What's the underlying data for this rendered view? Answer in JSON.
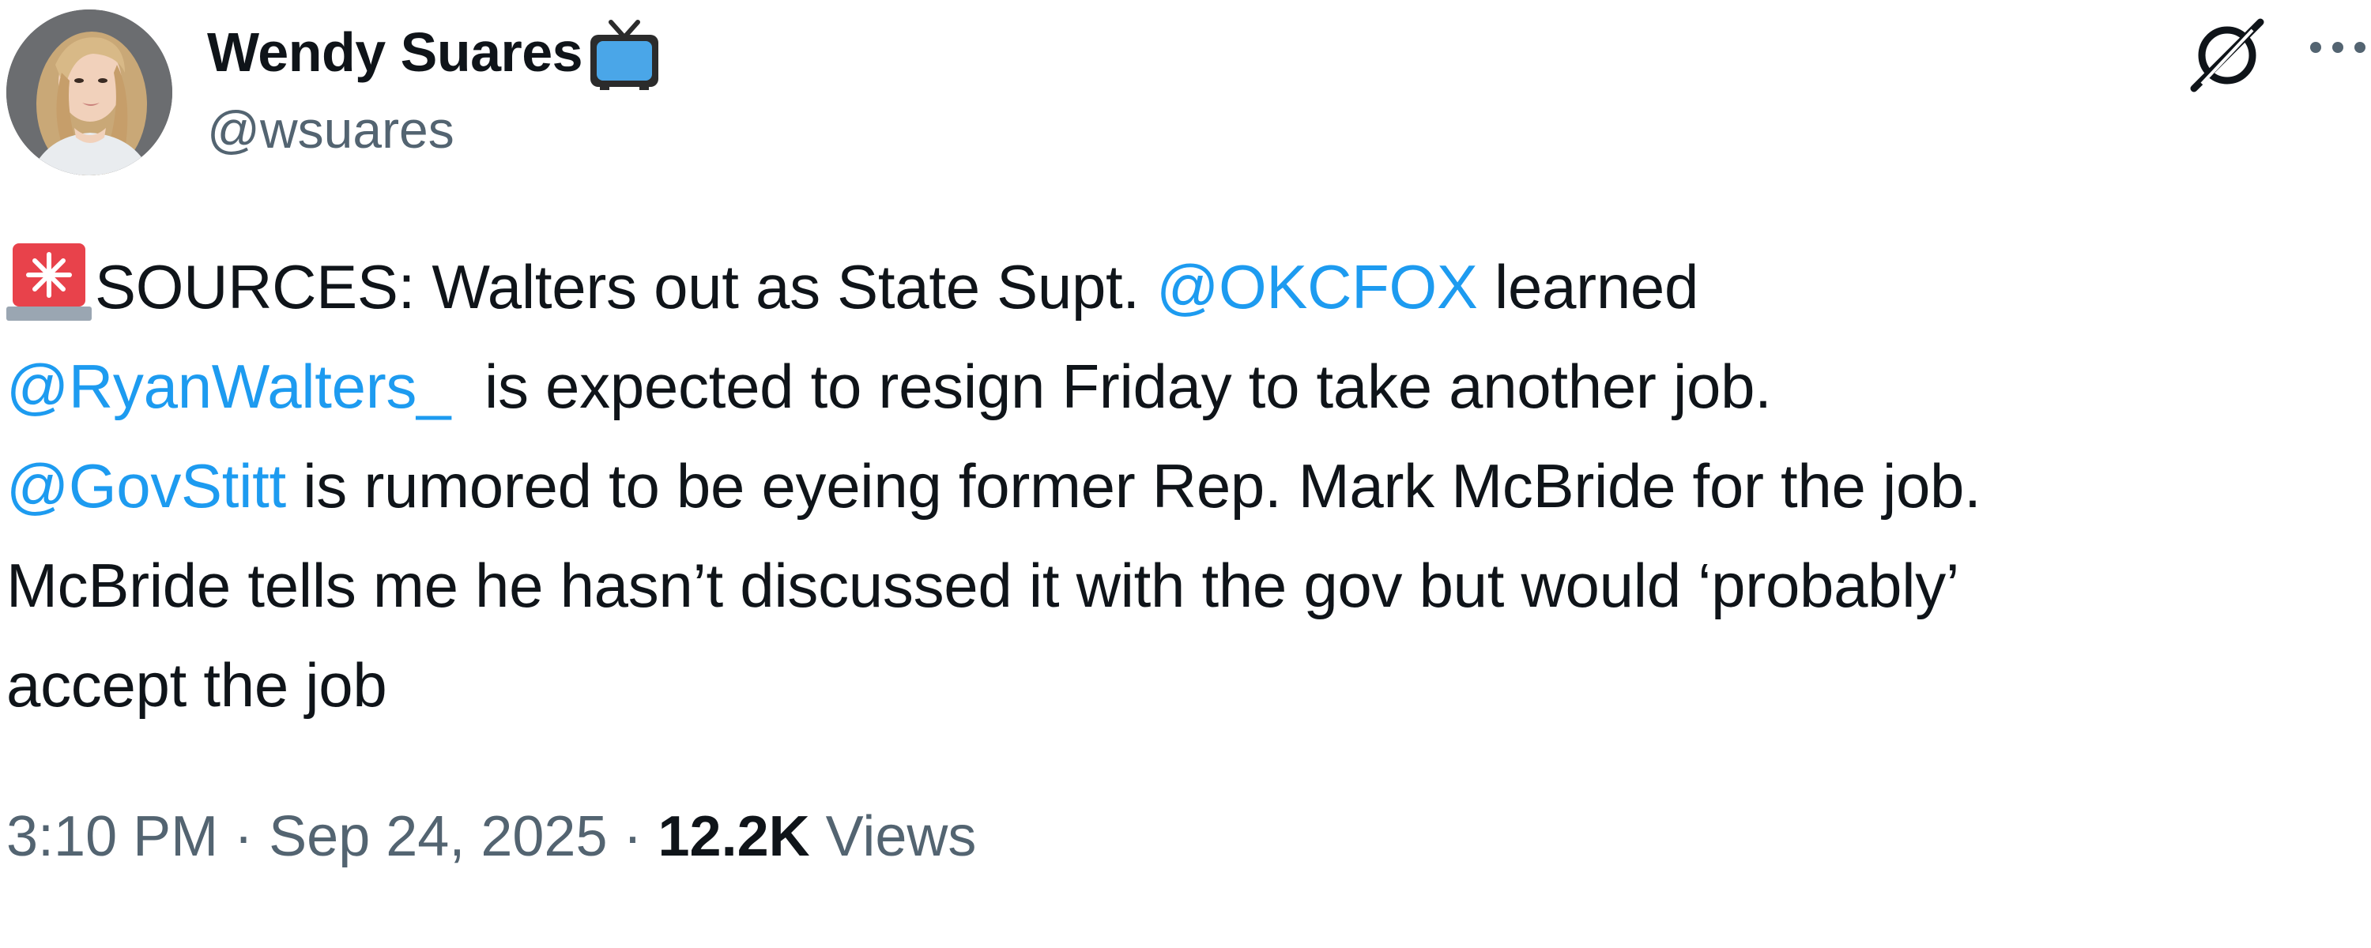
{
  "author": {
    "display_name": "Wendy Suares",
    "handle": "@wsuares",
    "badge_icon": "tv-icon"
  },
  "header_actions": {
    "grok_icon": "grok-icon",
    "more_icon": "more-icon"
  },
  "tweet": {
    "line1_text": "SOURCES: Walters out as State Supt. ",
    "line1_mention": "@OKCFOX",
    "line1_tail": " learned",
    "line2_mention": "@RyanWalters_",
    "line2_tail": "  is expected to resign Friday to take another job.",
    "line3_mention": "@GovStitt",
    "line3_tail": " is rumored to be eyeing former Rep. Mark McBride for the job.",
    "line4_text": "McBride tells me he hasn’t discussed it with the gov but would ‘probably’",
    "line5_text": "accept the job",
    "leading_emoji": "siren-icon"
  },
  "meta": {
    "time": "3:10 PM",
    "separator": " · ",
    "date": "Sep 24, 2025",
    "views_count": "12.2K",
    "views_label": " Views"
  },
  "colors": {
    "text": "#0f1419",
    "secondary": "#536471",
    "link": "#1d9bf0"
  }
}
